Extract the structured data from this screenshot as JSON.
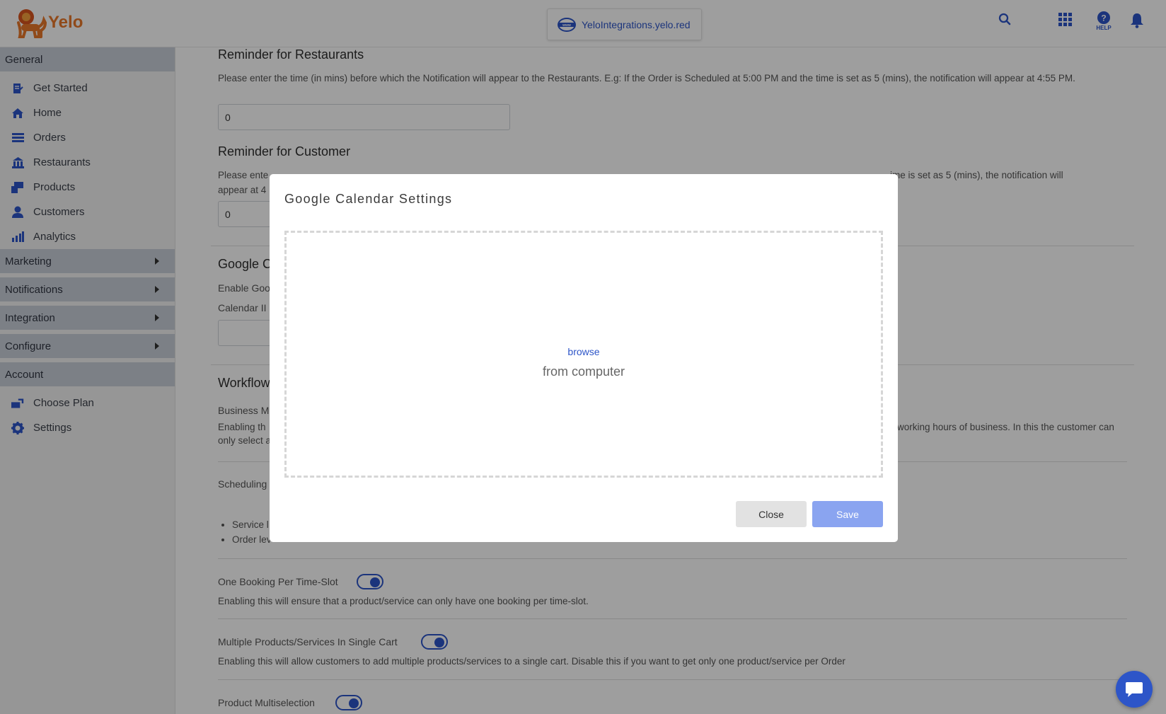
{
  "brand": {
    "name": "Yelo"
  },
  "header": {
    "domain": "YeloIntegrations.yelo.red",
    "help_label": "HELP"
  },
  "sidebar": {
    "general_label": "General",
    "general_items": [
      {
        "label": "Get Started",
        "icon": "get-started-icon"
      },
      {
        "label": "Home",
        "icon": "home-icon"
      },
      {
        "label": "Orders",
        "icon": "orders-icon"
      },
      {
        "label": "Restaurants",
        "icon": "restaurants-icon"
      },
      {
        "label": "Products",
        "icon": "products-icon"
      },
      {
        "label": "Customers",
        "icon": "customers-icon"
      },
      {
        "label": "Analytics",
        "icon": "analytics-icon"
      }
    ],
    "marketing_label": "Marketing",
    "notifications_label": "Notifications",
    "integration_label": "Integration",
    "configure_label": "Configure",
    "account_label": "Account",
    "account_items": [
      {
        "label": "Choose Plan",
        "icon": "choose-plan-icon"
      },
      {
        "label": "Settings",
        "icon": "settings-gear-icon"
      }
    ]
  },
  "main": {
    "reminder_restaurants": {
      "title": "Reminder for Restaurants",
      "desc": "Please enter the time (in mins) before which the Notification will appear to the Restaurants. E.g: If the Order is Scheduled at 5:00 PM and the time is set as 5 (mins), the notification will appear at 4:55 PM.",
      "value": "0"
    },
    "reminder_customer": {
      "title": "Reminder for Customer",
      "desc_left": "Please ente",
      "desc_right": "ime is set as 5 (mins), the notification will",
      "desc_line2": "appear at 4",
      "value": "0"
    },
    "google_section": {
      "title_partial": "Google C",
      "enable_partial": "Enable Goo",
      "calendar_partial": "Calendar II"
    },
    "workflow": {
      "title_partial": "Workflow",
      "business_partial": "Business M",
      "desc_left": "Enabling th",
      "desc_right": "working hours of business. In this the customer can",
      "desc_line2": "only select a",
      "scheduling_partial": "Scheduling",
      "bullet_1": "Service l",
      "bullet_2": "Order lev"
    },
    "one_booking": {
      "label": "One Booking Per Time-Slot",
      "desc": "Enabling this will ensure that a product/service can only have one booking per time-slot.",
      "enabled": true
    },
    "multiple_products": {
      "label": "Multiple Products/Services In Single Cart",
      "desc": "Enabling this will allow customers to add multiple products/services to a single cart. Disable this if you want to get only one product/service per Order",
      "enabled": true
    },
    "product_multiselection": {
      "label": "Product Multiselection",
      "enabled": true
    }
  },
  "modal": {
    "title": "Google Calendar Settings",
    "browse_label": "browse",
    "from_computer": "from computer",
    "close_label": "Close",
    "save_label": "Save"
  },
  "colors": {
    "accent": "#2d55c8",
    "brand_orange": "#e8782a",
    "sidebar_header": "#c9cfd8",
    "save_disabled": "#8aa4f0"
  }
}
